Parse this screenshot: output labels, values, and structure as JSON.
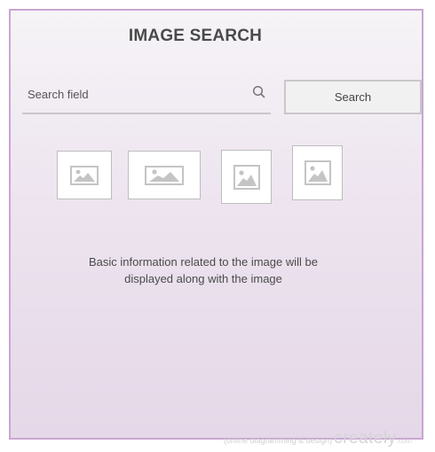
{
  "page": {
    "title": "IMAGE SEARCH"
  },
  "search": {
    "placeholder": "Search field",
    "value": "",
    "button_label": "Search",
    "icon": "search-icon"
  },
  "results": {
    "thumbnails": [
      {
        "icon": "image-placeholder-icon"
      },
      {
        "icon": "image-placeholder-icon"
      },
      {
        "icon": "image-placeholder-icon"
      },
      {
        "icon": "image-placeholder-icon"
      }
    ],
    "info_text": "Basic information related  to the image will be\ndisplayed along with the image"
  },
  "watermark": {
    "tagline": "(online diagramming & design)",
    "brand": "creately",
    "tld": ".com"
  },
  "colors": {
    "frame_border": "#c8a6d2",
    "gradient_top": "#f6f4f7",
    "gradient_bottom": "#e5d8e8",
    "text": "#4a4a4a",
    "placeholder_icon": "#c4c4c4"
  }
}
